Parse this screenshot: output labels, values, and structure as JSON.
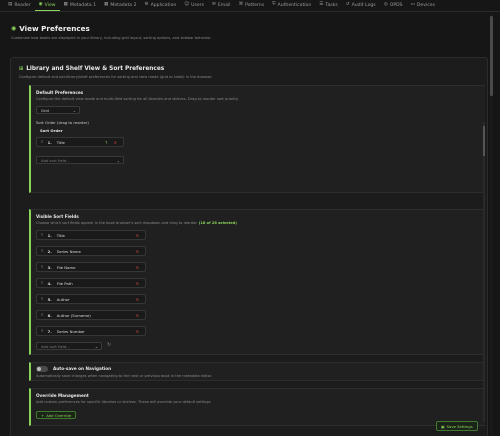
{
  "tabs": [
    {
      "label": "Reader",
      "icon": "▤",
      "icon_name": "reader-icon"
    },
    {
      "label": "View",
      "icon": "◉",
      "icon_name": "eye-icon",
      "active": true
    },
    {
      "label": "Metadata 1",
      "icon": "▦",
      "icon_name": "metadata-icon"
    },
    {
      "label": "Metadata 2",
      "icon": "▦",
      "icon_name": "metadata-icon"
    },
    {
      "label": "Application",
      "icon": "⚙",
      "icon_name": "gear-icon"
    },
    {
      "label": "Users",
      "icon": "☺",
      "icon_name": "users-icon"
    },
    {
      "label": "Email",
      "icon": "✉",
      "icon_name": "email-icon"
    },
    {
      "label": "Patterns",
      "icon": "⌘",
      "icon_name": "patterns-icon"
    },
    {
      "label": "Authentication",
      "icon": "⛨",
      "icon_name": "shield-icon"
    },
    {
      "label": "Tasks",
      "icon": "☰",
      "icon_name": "tasks-icon"
    },
    {
      "label": "Audit Logs",
      "icon": "↺",
      "icon_name": "history-icon"
    },
    {
      "label": "OPDS",
      "icon": "◎",
      "icon_name": "opds-icon"
    },
    {
      "label": "Devices",
      "icon": "▭",
      "icon_name": "device-icon"
    }
  ],
  "page": {
    "title": "View Preferences",
    "description": "Customize how books are displayed in your library, including grid layout, sorting options, and sidebar behavior."
  },
  "panel": {
    "title": "Library and Shelf View & Sort Preferences",
    "description": "Configure default and per-library/shelf preferences for sorting and view mode (grid or table) in the browser."
  },
  "default_prefs": {
    "title": "Default Preferences",
    "description": "Configure the default view mode and multi-field sorting for all libraries and shelves. Drag to reorder sort priority.",
    "view_mode": "Grid",
    "sort_order_label": "Sort Order (drag to reorder)",
    "sort_order_title": "Sort Order",
    "sort_items": [
      {
        "num": "1.",
        "label": "Title"
      }
    ],
    "add_sort_placeholder": "Add sort field..."
  },
  "visible_sort": {
    "title": "Visible Sort Fields",
    "description": "Choose which sort fields appear in the book browser's sort dropdown and drag to reorder.",
    "selected_text": "(18 of 28 selected)",
    "items": [
      {
        "num": "1.",
        "label": "Title"
      },
      {
        "num": "2.",
        "label": "Series Name"
      },
      {
        "num": "3.",
        "label": "File Name"
      },
      {
        "num": "4.",
        "label": "File Path"
      },
      {
        "num": "5.",
        "label": "Author"
      },
      {
        "num": "6.",
        "label": "Author (Surname)"
      },
      {
        "num": "7.",
        "label": "Series Number"
      }
    ],
    "add_placeholder": "Add sort field..."
  },
  "autosave": {
    "title": "Auto-save on Navigation",
    "description": "Automatically save changes when navigating to the next or previous book in the metadata editor.",
    "enabled": false
  },
  "override": {
    "title": "Override Management",
    "description": "Add custom preferences for specific libraries or shelves. These will override your default settings.",
    "add_label": "Add Override"
  },
  "save_label": "Save Settings",
  "colors": {
    "accent": "#8bd45a",
    "danger": "#e34a4a",
    "background": "#161616"
  }
}
